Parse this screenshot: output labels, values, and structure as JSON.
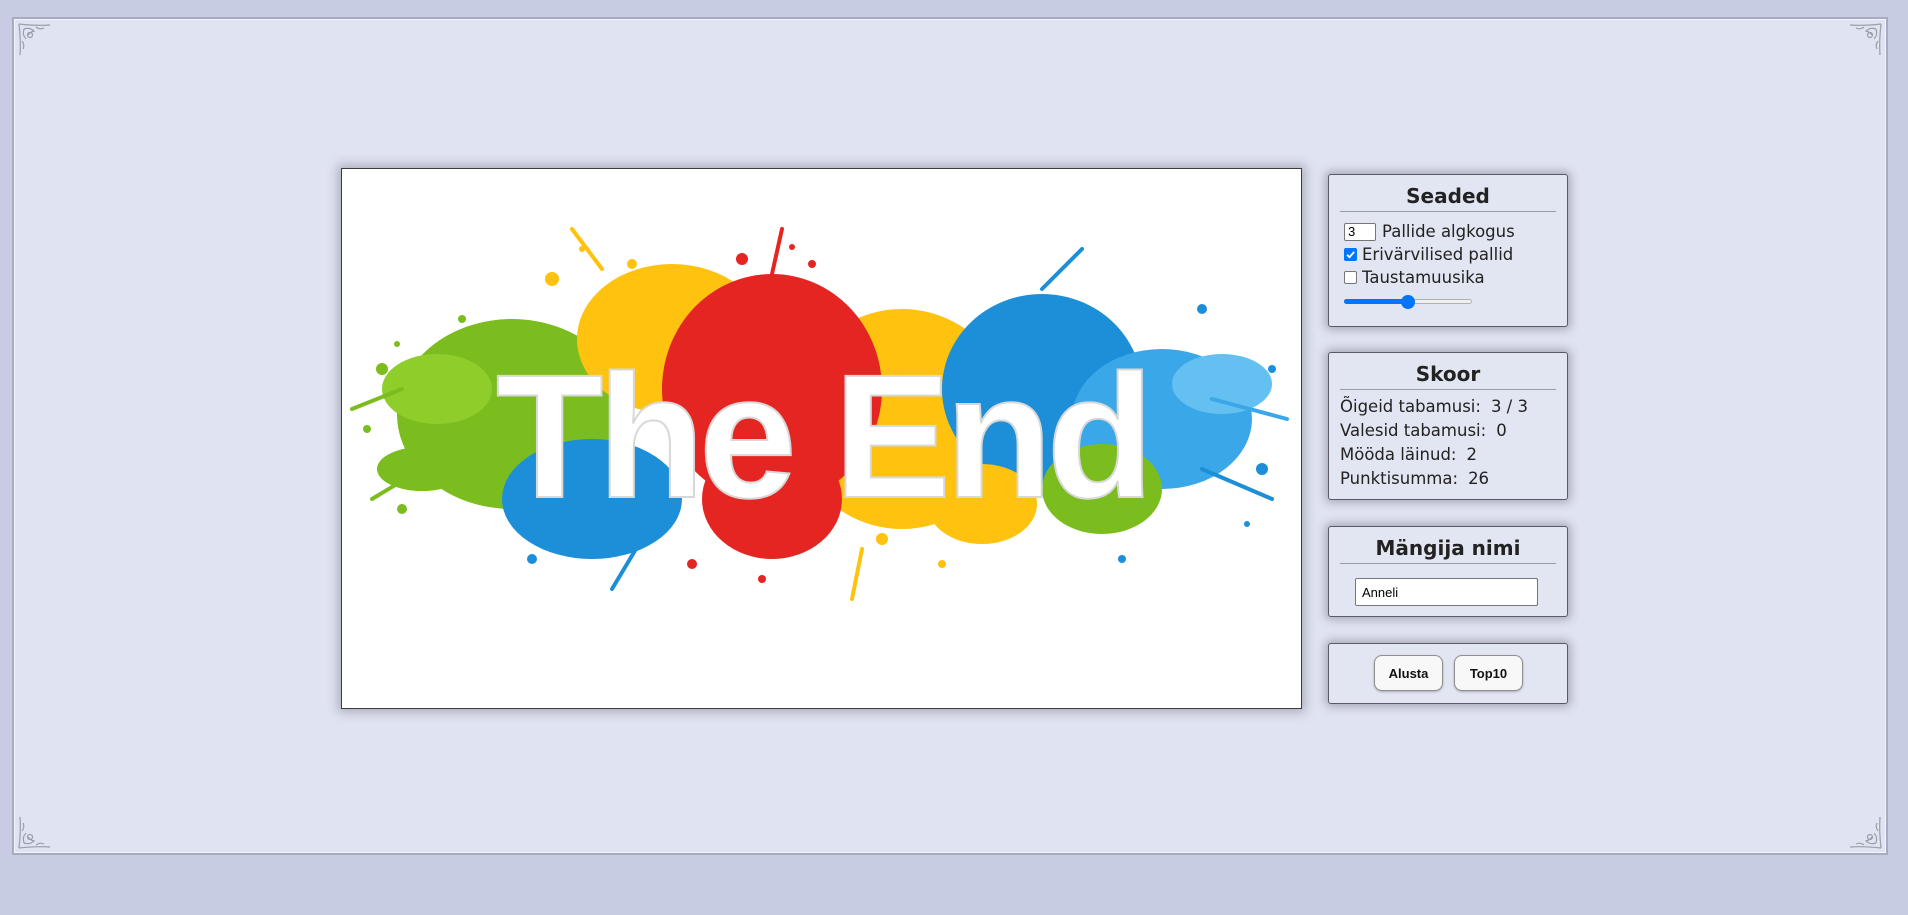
{
  "game_image": {
    "text": "The End",
    "splash_colors": [
      "#7bbd1f",
      "#ffc20e",
      "#e52521",
      "#1d8fd8",
      "#64c0f0"
    ]
  },
  "settings": {
    "title": "Seaded",
    "ball_count_value": "3",
    "ball_count_label": "Pallide algkogus",
    "colorful_balls_label": "Erivärvilised pallid",
    "colorful_balls_checked": true,
    "music_label": "Taustamuusika",
    "music_checked": false,
    "volume_level": 0.5
  },
  "score": {
    "title": "Skoor",
    "correct_label": "Õigeid tabamusi:",
    "correct_value": "3 / 3",
    "wrong_label": "Valesid tabamusi:",
    "wrong_value": "0",
    "missed_label": "Mööda läinud:",
    "missed_value": "2",
    "total_label": "Punktisumma:",
    "total_value": "26"
  },
  "player": {
    "title": "Mängija nimi",
    "name_value": "Anneli"
  },
  "buttons": {
    "start_label": "Alusta",
    "top10_label": "Top10"
  },
  "colors": {
    "background": "#c8cce3",
    "panel": "#e2e5f2",
    "accent": "#0075ff"
  }
}
